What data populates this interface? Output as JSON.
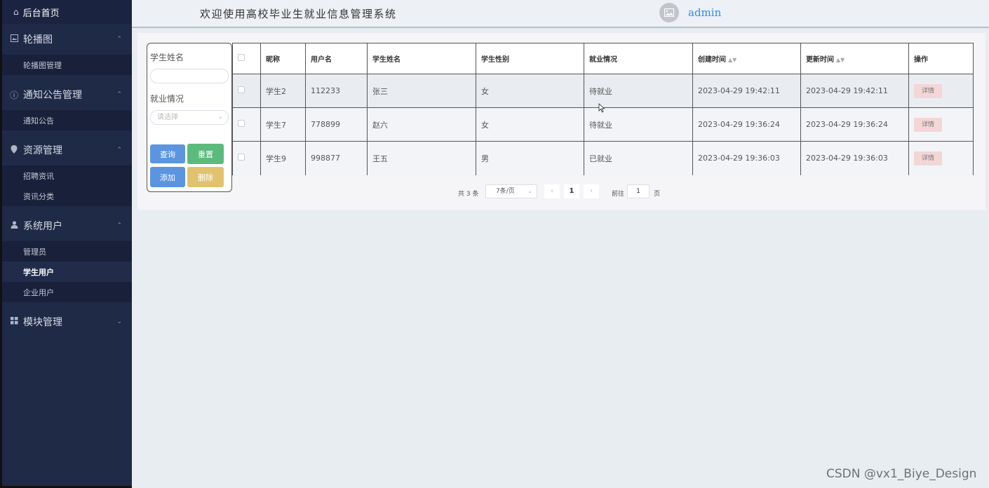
{
  "sidebar": {
    "home_label": "后台首页",
    "groups": [
      {
        "label": "轮播图",
        "icon": "image-icon",
        "items": [
          "轮播图管理"
        ]
      },
      {
        "label": "通知公告管理",
        "icon": "info-circle-icon",
        "items": [
          "通知公告"
        ]
      },
      {
        "label": "资源管理",
        "icon": "location-pin-icon",
        "items": [
          "招聘资讯",
          "资讯分类"
        ]
      },
      {
        "label": "系统用户",
        "icon": "user-icon",
        "items": [
          "管理员",
          "学生用户",
          "企业用户"
        ],
        "active_item": "学生用户"
      },
      {
        "label": "模块管理",
        "icon": "grid-icon",
        "items": []
      }
    ]
  },
  "header": {
    "welcome": "欢迎使用高校毕业生就业信息管理系统",
    "username": "admin"
  },
  "search": {
    "name_label": "学生姓名",
    "name_value": "",
    "status_label": "就业情况",
    "status_placeholder": "请选择",
    "query_btn": "查询",
    "reset_btn": "重置",
    "add_btn": "添加",
    "delete_btn": "删除"
  },
  "table": {
    "headers": [
      "昵称",
      "用户名",
      "学生姓名",
      "学生性别",
      "就业情况",
      "创建时间",
      "更新时间",
      "操作"
    ],
    "rows": [
      {
        "nickname": "学生2",
        "username": "112233",
        "name": "张三",
        "gender": "女",
        "status": "待就业",
        "created": "2023-04-29 19:42:11",
        "updated": "2023-04-29 19:42:11",
        "action": "详情"
      },
      {
        "nickname": "学生7",
        "username": "778899",
        "name": "赵六",
        "gender": "女",
        "status": "待就业",
        "created": "2023-04-29 19:36:24",
        "updated": "2023-04-29 19:36:24",
        "action": "详情"
      },
      {
        "nickname": "学生9",
        "username": "998877",
        "name": "王五",
        "gender": "男",
        "status": "已就业",
        "created": "2023-04-29 19:36:03",
        "updated": "2023-04-29 19:36:03",
        "action": "详情"
      }
    ]
  },
  "pagination": {
    "total": "共 3 条",
    "page_size": "7条/页",
    "current_page": "1",
    "goto_label": "前往",
    "goto_value": "1",
    "page_unit": "页"
  },
  "watermark": "CSDN @vx1_Biye_Design",
  "colors": {
    "sidebar_bg": "#1f2a47",
    "accent_blue": "#2d8cf0",
    "query_btn": "#5b95e0",
    "reset_btn": "#5cba7d",
    "delete_btn": "#e1c36f",
    "detail_btn": "#f3d6d6"
  }
}
